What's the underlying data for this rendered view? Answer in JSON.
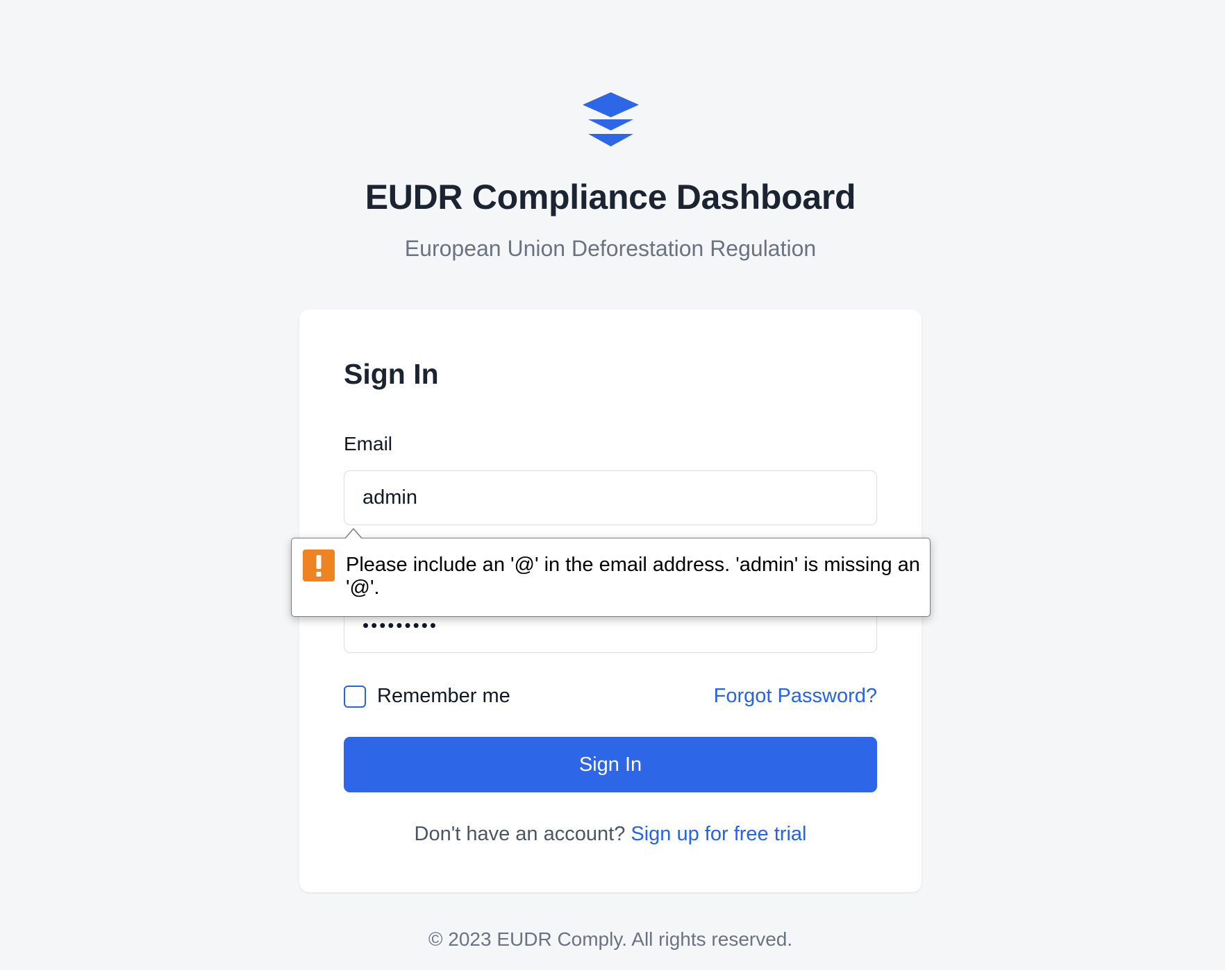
{
  "app": {
    "title": "EUDR Compliance Dashboard",
    "subtitle": "European Union Deforestation Regulation",
    "logo_icon": "layers-icon",
    "brand_color": "#2e66e8"
  },
  "signin": {
    "heading": "Sign In",
    "email_label": "Email",
    "email_value": "admin",
    "password_value": "•••••••••",
    "remember_label": "Remember me",
    "remember_checked": false,
    "forgot_label": "Forgot Password?",
    "submit_label": "Sign In",
    "signup_prompt": "Don't have an account?",
    "signup_link": "Sign up for free trial"
  },
  "validation": {
    "icon": "warning-icon",
    "icon_color": "#ee8421",
    "message": "Please include an '@' in the email address. 'admin' is missing an '@'."
  },
  "footer": {
    "text": "© 2023 EUDR Comply. All rights reserved."
  }
}
